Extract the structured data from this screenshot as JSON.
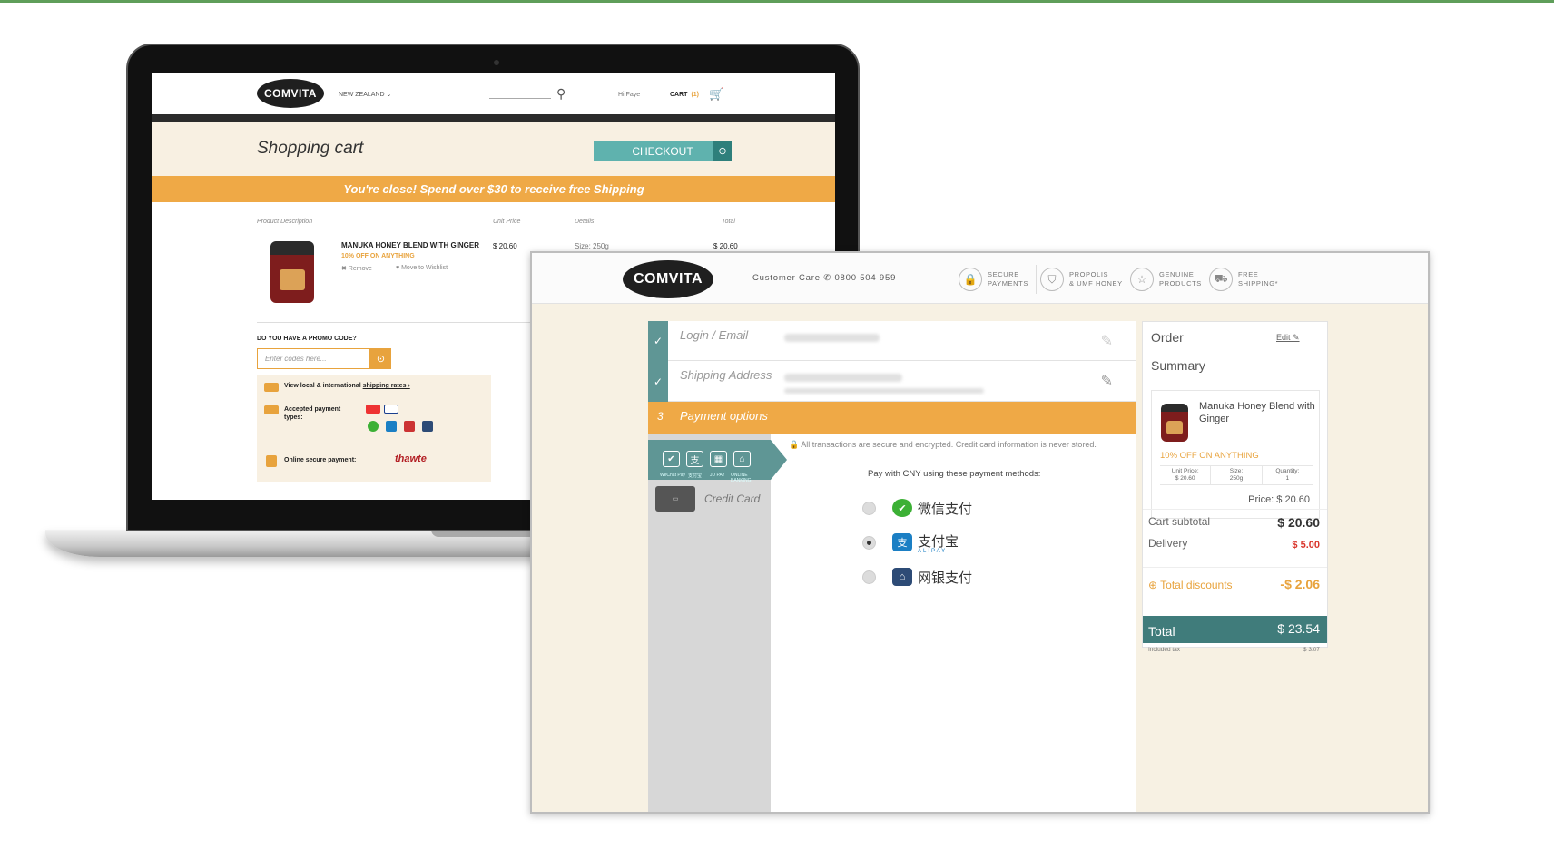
{
  "colors": {
    "brand_orange": "#efa946",
    "teal": "#5fb2ae",
    "dark_teal": "#407c7b",
    "cream": "#f8f0e2",
    "alert_red": "#d9352b"
  },
  "laptop": {
    "logo": "COMVITA",
    "country": "NEW ZEALAND ⌄",
    "search_icon": "search-icon",
    "greeting": "Hi Faye",
    "cart_label": "CART",
    "cart_count": "(1)",
    "page_title": "Shopping cart",
    "checkout_label": "CHECKOUT",
    "banner": "You're close! Spend over $30 to receive free Shipping",
    "columns": [
      "Product Description",
      "Unit Price",
      "Details",
      "Total"
    ],
    "product": {
      "name": "MANUKA HONEY BLEND WITH GINGER",
      "offer": "10% OFF ON ANYTHING",
      "remove": "✖ Remove",
      "wishlist": "♥ Move to Wishlist",
      "unit_price": "$ 20.60",
      "size": "Size:   250g",
      "total": "$ 20.60"
    },
    "promo": {
      "label": "DO YOU HAVE A PROMO CODE?",
      "placeholder": "Enter codes here..."
    },
    "info": {
      "shipping_text": "View local & international",
      "shipping_link": "shipping rates ›",
      "payment_text": "Accepted payment types:",
      "secure_text": "Online secure payment:",
      "thawte": "thawte"
    }
  },
  "checkout": {
    "logo": "COMVITA",
    "care": "Customer Care ✆ 0800 504 959",
    "badges": [
      {
        "icon": "lock-icon",
        "line1": "SECURE",
        "line2": "PAYMENTS"
      },
      {
        "icon": "shield-icon",
        "line1": "PROPOLIS",
        "line2": "& UMF HONEY"
      },
      {
        "icon": "star-icon",
        "line1": "GENUINE",
        "line2": "PRODUCTS"
      },
      {
        "icon": "truck-icon",
        "line1": "FREE",
        "line2": "SHIPPING*"
      }
    ],
    "step_login": "Login / Email",
    "step_shipping": "Shipping Address",
    "step_payment_num": "3",
    "step_payment": "Payment options",
    "methods": [
      "WeChat Pay",
      "支付宝",
      "JD PAY",
      "ONLINE BANKING"
    ],
    "credit_card": "Credit Card",
    "secure_note": "🔒 All transactions are secure and encrypted. Credit card information is never stored.",
    "pay_info": "Pay with CNY using these payment methods:",
    "options": [
      {
        "label": "微信支付",
        "sub": "",
        "selected": false
      },
      {
        "label": "支付宝",
        "sub": "ALIPAY",
        "selected": true
      },
      {
        "label": "网银支付",
        "sub": "",
        "selected": false
      }
    ]
  },
  "summary": {
    "title1": "Order",
    "title2": "Summary",
    "edit": "Edit ✎",
    "product_name": "Manuka Honey Blend with Ginger",
    "offer": "10% OFF ON ANYTHING",
    "grid": [
      {
        "label": "Unit Price:",
        "value": "$ 20.60"
      },
      {
        "label": "Size:",
        "value": "250g"
      },
      {
        "label": "Quantity:",
        "value": "1"
      }
    ],
    "price": "Price: $ 20.60",
    "cart_subtotal_label": "Cart subtotal",
    "cart_subtotal": "$ 20.60",
    "delivery_label": "Delivery",
    "delivery": "$ 5.00",
    "discounts_label": "⊕ Total discounts",
    "discounts": "-$ 2.06",
    "total_label": "Total",
    "total": "$ 23.54",
    "tax_label": "Included tax",
    "tax": "$ 3.07"
  }
}
